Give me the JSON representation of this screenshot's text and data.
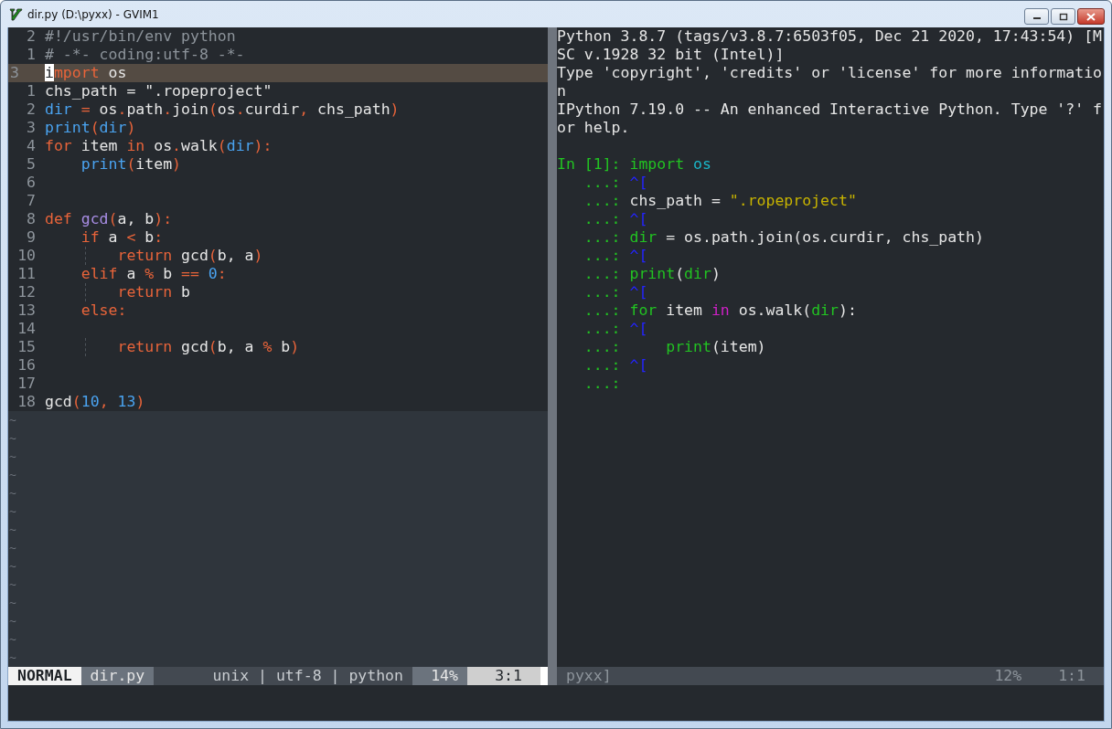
{
  "window": {
    "title": "dir.py (D:\\pyxx) - GVIM1"
  },
  "editor": {
    "lines": [
      {
        "number": "2",
        "current": false,
        "tokens": [
          {
            "text": "#!/usr/bin/env python",
            "kind": "comment"
          }
        ]
      },
      {
        "number": "1",
        "current": false,
        "tokens": [
          {
            "text": "# -*- coding:utf-8 -*-",
            "kind": "comment"
          }
        ]
      },
      {
        "number": "3",
        "current": true,
        "tokens": [
          {
            "text": "i",
            "kind": "cursor"
          },
          {
            "text": "mport",
            "kind": "keyword"
          },
          {
            "text": " os",
            "kind": "plain"
          }
        ]
      },
      {
        "number": "1",
        "current": false,
        "tokens": [
          {
            "text": "chs_path = \".ropeproject\"",
            "kind": "plain"
          }
        ]
      },
      {
        "number": "2",
        "current": false,
        "tokens": [
          {
            "text": "dir",
            "kind": "builtin"
          },
          {
            "text": " =",
            "kind": "operator"
          },
          {
            "text": " os",
            "kind": "plain"
          },
          {
            "text": ".",
            "kind": "operator"
          },
          {
            "text": "path",
            "kind": "plain"
          },
          {
            "text": ".",
            "kind": "operator"
          },
          {
            "text": "join",
            "kind": "plain"
          },
          {
            "text": "(",
            "kind": "operator"
          },
          {
            "text": "os",
            "kind": "plain"
          },
          {
            "text": ".",
            "kind": "operator"
          },
          {
            "text": "curdir",
            "kind": "plain"
          },
          {
            "text": ",",
            "kind": "operator"
          },
          {
            "text": " chs_path",
            "kind": "plain"
          },
          {
            "text": ")",
            "kind": "operator"
          }
        ]
      },
      {
        "number": "3",
        "current": false,
        "tokens": [
          {
            "text": "print",
            "kind": "builtin"
          },
          {
            "text": "(",
            "kind": "operator"
          },
          {
            "text": "dir",
            "kind": "builtin"
          },
          {
            "text": ")",
            "kind": "operator"
          }
        ]
      },
      {
        "number": "4",
        "current": false,
        "tokens": [
          {
            "text": "for",
            "kind": "keyword"
          },
          {
            "text": " item ",
            "kind": "plain"
          },
          {
            "text": "in",
            "kind": "keyword"
          },
          {
            "text": " os",
            "kind": "plain"
          },
          {
            "text": ".",
            "kind": "operator"
          },
          {
            "text": "walk",
            "kind": "plain"
          },
          {
            "text": "(",
            "kind": "operator"
          },
          {
            "text": "dir",
            "kind": "builtin"
          },
          {
            "text": "):",
            "kind": "operator"
          }
        ]
      },
      {
        "number": "5",
        "current": false,
        "tokens": [
          {
            "text": "    print",
            "kind": "builtin"
          },
          {
            "text": "(",
            "kind": "operator"
          },
          {
            "text": "item",
            "kind": "plain"
          },
          {
            "text": ")",
            "kind": "operator"
          }
        ]
      },
      {
        "number": "6",
        "current": false
      },
      {
        "number": "7",
        "current": false
      },
      {
        "number": "8",
        "current": false,
        "tokens": [
          {
            "text": "def",
            "kind": "keyword"
          },
          {
            "text": " gcd",
            "kind": "func"
          },
          {
            "text": "(",
            "kind": "operator"
          },
          {
            "text": "a, b",
            "kind": "plain"
          },
          {
            "text": "):",
            "kind": "operator"
          }
        ]
      },
      {
        "number": "9",
        "current": false,
        "tokens": [
          {
            "text": "    if",
            "kind": "keyword"
          },
          {
            "text": " a ",
            "kind": "plain"
          },
          {
            "text": "<",
            "kind": "operator"
          },
          {
            "text": " b",
            "kind": "plain"
          },
          {
            "text": ":",
            "kind": "operator"
          }
        ]
      },
      {
        "number": "10",
        "current": false,
        "guide": true,
        "tokens": [
          {
            "text": "        return",
            "kind": "keyword"
          },
          {
            "text": " gcd",
            "kind": "plain"
          },
          {
            "text": "(",
            "kind": "operator"
          },
          {
            "text": "b, a",
            "kind": "plain"
          },
          {
            "text": ")",
            "kind": "operator"
          }
        ]
      },
      {
        "number": "11",
        "current": false,
        "tokens": [
          {
            "text": "    elif",
            "kind": "keyword"
          },
          {
            "text": " a ",
            "kind": "plain"
          },
          {
            "text": "%",
            "kind": "operator"
          },
          {
            "text": " b ",
            "kind": "plain"
          },
          {
            "text": "==",
            "kind": "operator"
          },
          {
            "text": " 0",
            "kind": "number"
          },
          {
            "text": ":",
            "kind": "operator"
          }
        ]
      },
      {
        "number": "12",
        "current": false,
        "guide": true,
        "tokens": [
          {
            "text": "        return",
            "kind": "keyword"
          },
          {
            "text": " b",
            "kind": "plain"
          }
        ]
      },
      {
        "number": "13",
        "current": false,
        "tokens": [
          {
            "text": "    else:",
            "kind": "keyword"
          }
        ]
      },
      {
        "number": "14",
        "current": false
      },
      {
        "number": "15",
        "current": false,
        "guide": true,
        "tokens": [
          {
            "text": "        return",
            "kind": "keyword"
          },
          {
            "text": " gcd",
            "kind": "plain"
          },
          {
            "text": "(",
            "kind": "operator"
          },
          {
            "text": "b, a ",
            "kind": "plain"
          },
          {
            "text": "%",
            "kind": "operator"
          },
          {
            "text": " b",
            "kind": "plain"
          },
          {
            "text": ")",
            "kind": "operator"
          }
        ]
      },
      {
        "number": "16",
        "current": false
      },
      {
        "number": "17",
        "current": false
      },
      {
        "number": "18",
        "current": false,
        "tokens": [
          {
            "text": "gcd",
            "kind": "plain"
          },
          {
            "text": "(",
            "kind": "operator"
          },
          {
            "text": "10",
            "kind": "number"
          },
          {
            "text": ",",
            "kind": "operator"
          },
          {
            "text": " 13",
            "kind": "number"
          },
          {
            "text": ")",
            "kind": "operator"
          }
        ]
      }
    ],
    "tildes": [
      "~",
      "~",
      "~",
      "~",
      "~",
      "~",
      "~",
      "~",
      "~",
      "~",
      "~",
      "~",
      "~",
      "~"
    ],
    "statusline": {
      "mode": "NORMAL",
      "file": "dir.py",
      "info": "unix | utf-8 | python",
      "percent": "14%",
      "position": "3:1"
    }
  },
  "console": {
    "lines": [
      {
        "tokens": [
          {
            "text": "Python 3.8.7 (tags/v3.8.7:6503f05, Dec 21 2020, 17:43:54) [M",
            "kind": "plain"
          }
        ]
      },
      {
        "tokens": [
          {
            "text": "SC v.1928 32 bit (Intel)]",
            "kind": "plain"
          }
        ]
      },
      {
        "tokens": [
          {
            "text": "Type 'copyright', 'credits' or 'license' for more informatio",
            "kind": "plain"
          }
        ]
      },
      {
        "tokens": [
          {
            "text": "n",
            "kind": "plain"
          }
        ]
      },
      {
        "tokens": [
          {
            "text": "IPython 7.19.0 -- An enhanced Interactive Python. Type '?' f",
            "kind": "plain"
          }
        ]
      },
      {
        "tokens": [
          {
            "text": "or help.",
            "kind": "plain"
          }
        ]
      },
      {
        "blank_before": true,
        "tokens": [
          {
            "text": "In [1]: ",
            "kind": "prompt"
          },
          {
            "text": "import",
            "kind": "green"
          },
          {
            "text": " os",
            "kind": "cyan"
          }
        ]
      },
      {
        "tokens": [
          {
            "text": "   ...: ",
            "kind": "prompt"
          },
          {
            "text": "^[",
            "kind": "escape"
          }
        ]
      },
      {
        "tokens": [
          {
            "text": "   ...: ",
            "kind": "prompt"
          },
          {
            "text": "chs_path = ",
            "kind": "plain"
          },
          {
            "text": "\".ropeproject\"",
            "kind": "string"
          }
        ]
      },
      {
        "tokens": [
          {
            "text": "   ...: ",
            "kind": "prompt"
          },
          {
            "text": "^[",
            "kind": "escape"
          }
        ]
      },
      {
        "tokens": [
          {
            "text": "   ...: ",
            "kind": "prompt"
          },
          {
            "text": "dir",
            "kind": "green"
          },
          {
            "text": " = os.path.join(os.curdir, chs_path)",
            "kind": "plain"
          }
        ]
      },
      {
        "tokens": [
          {
            "text": "   ...: ",
            "kind": "prompt"
          },
          {
            "text": "^[",
            "kind": "escape"
          }
        ]
      },
      {
        "tokens": [
          {
            "text": "   ...: ",
            "kind": "prompt"
          },
          {
            "text": "print",
            "kind": "green"
          },
          {
            "text": "(",
            "kind": "plain"
          },
          {
            "text": "dir",
            "kind": "green"
          },
          {
            "text": ")",
            "kind": "plain"
          }
        ]
      },
      {
        "tokens": [
          {
            "text": "   ...: ",
            "kind": "prompt"
          },
          {
            "text": "^[",
            "kind": "escape"
          }
        ]
      },
      {
        "tokens": [
          {
            "text": "   ...: ",
            "kind": "prompt"
          },
          {
            "text": "for",
            "kind": "green"
          },
          {
            "text": " item ",
            "kind": "plain"
          },
          {
            "text": "in",
            "kind": "magenta"
          },
          {
            "text": " os.walk(",
            "kind": "plain"
          },
          {
            "text": "dir",
            "kind": "green"
          },
          {
            "text": "):",
            "kind": "plain"
          }
        ]
      },
      {
        "tokens": [
          {
            "text": "   ...: ",
            "kind": "prompt"
          },
          {
            "text": "^[",
            "kind": "escape"
          }
        ]
      },
      {
        "tokens": [
          {
            "text": "   ...:     ",
            "kind": "prompt"
          },
          {
            "text": "print",
            "kind": "green"
          },
          {
            "text": "(item)",
            "kind": "plain"
          }
        ]
      },
      {
        "tokens": [
          {
            "text": "   ...: ",
            "kind": "prompt"
          },
          {
            "text": "^[",
            "kind": "escape"
          }
        ]
      },
      {
        "tokens": [
          {
            "text": "   ...:",
            "kind": "prompt"
          }
        ]
      }
    ],
    "statusline": {
      "name": "pyxx]",
      "percent": "12%",
      "position": "1:1"
    }
  }
}
